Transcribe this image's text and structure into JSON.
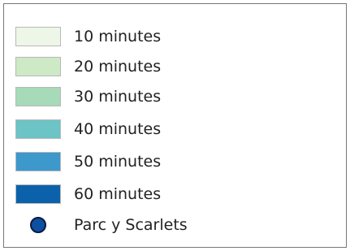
{
  "legend": {
    "items": [
      {
        "label": "10 minutes",
        "color": "#eef7e7"
      },
      {
        "label": "20 minutes",
        "color": "#cde9c6"
      },
      {
        "label": "30 minutes",
        "color": "#a6dab8"
      },
      {
        "label": "40 minutes",
        "color": "#6cc4c6"
      },
      {
        "label": "50 minutes",
        "color": "#3d98cc"
      },
      {
        "label": "60 minutes",
        "color": "#0b62ab"
      }
    ],
    "marker": {
      "label": "Parc y Scarlets",
      "color": "#0d4fa0",
      "icon": "circle-marker-icon"
    }
  }
}
